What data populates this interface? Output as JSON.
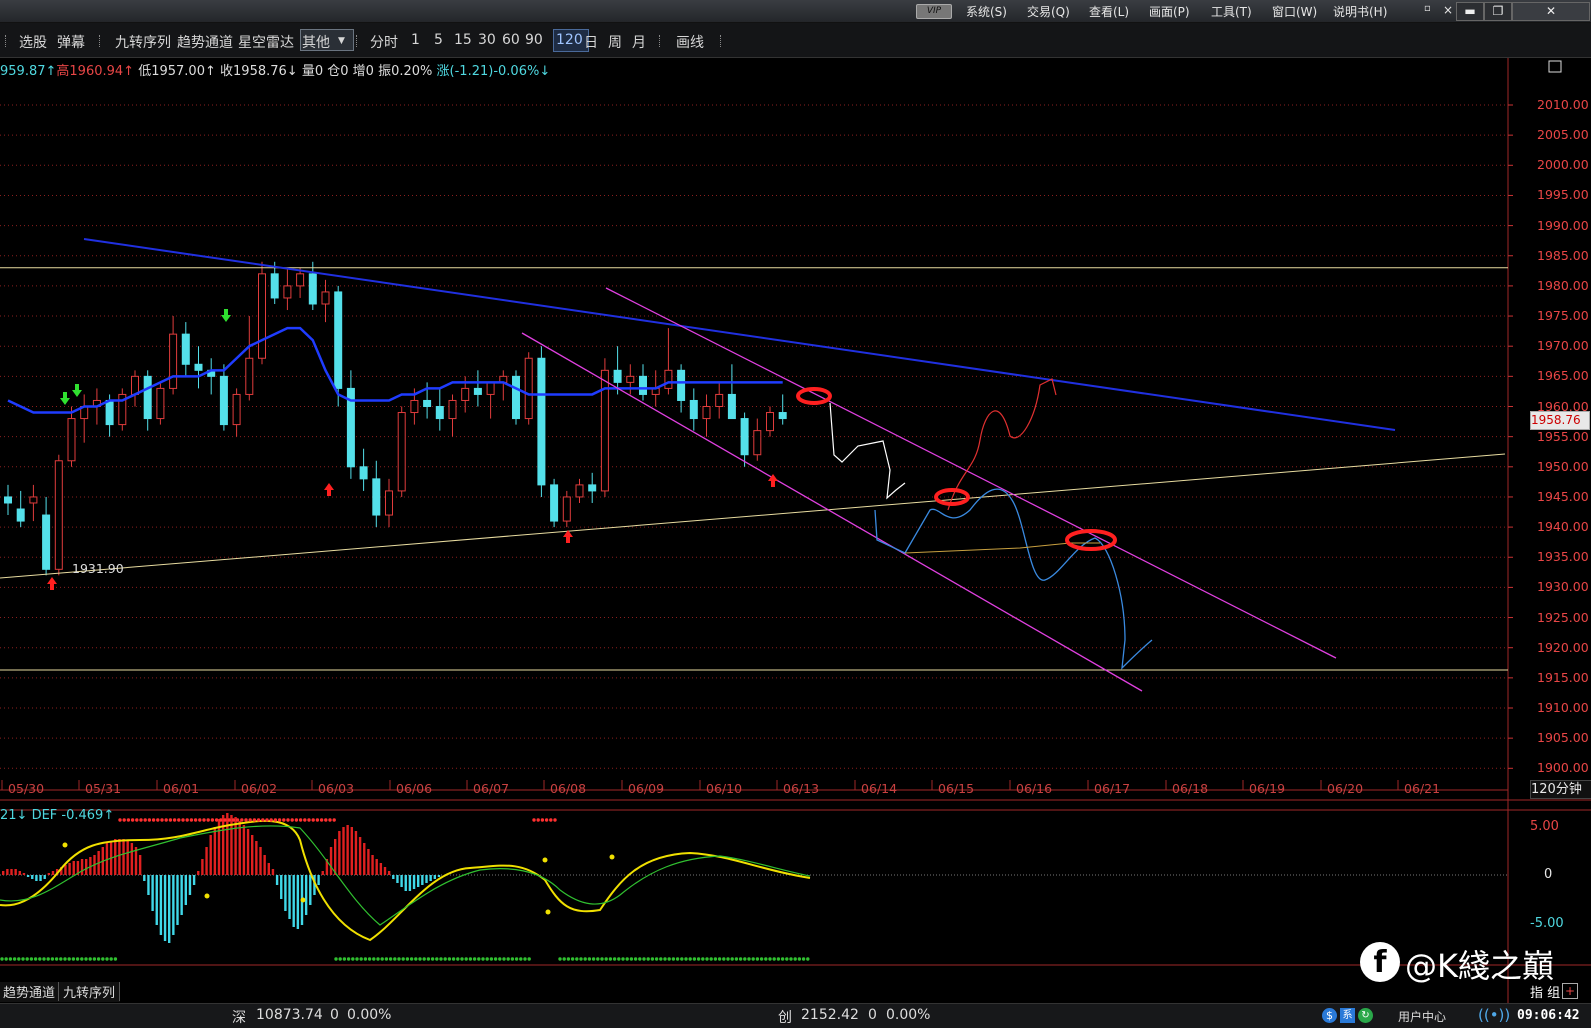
{
  "menu": [
    "系统(S)",
    "交易(Q)",
    "查看(L)",
    "画面(P)",
    "工具(T)",
    "窗口(W)",
    "说明书(H)"
  ],
  "vip": "VIP",
  "toolbar": {
    "items": [
      "选股",
      "弹幕",
      "九转序列",
      "趋势通道",
      "星空雷达"
    ],
    "dropdown": "其他",
    "periods": [
      "分时",
      "1",
      "5",
      "15",
      "30",
      "60",
      "90",
      "120",
      "日",
      "周",
      "月"
    ],
    "draw": "画线",
    "selected_period": "120"
  },
  "infobar": {
    "open": "959.87↑",
    "high_label": "高",
    "high": "1960.94↑",
    "low_label": "低",
    "low": "1957.00↑",
    "close_label": "收",
    "close": "1958.76↓",
    "vol": "量0",
    "pos": "仓0",
    "inc": "增0",
    "amp": "振0.20%",
    "chg": "涨(-1.21)-0.06%↓"
  },
  "current_price": "1958.76",
  "low_marker": "1931.90",
  "period_label": "120分钟",
  "indicator": {
    "left": "21↓",
    "def": "DEF -0.469↑",
    "ticks": [
      "5.00",
      "0",
      "-5.00",
      "0"
    ]
  },
  "bottom_tabs": [
    "趋势通道",
    "九转序列"
  ],
  "right_tabs": "指 组",
  "status": {
    "sz_label": "深",
    "sz_value": "10873.74",
    "sz_chg": "0",
    "sz_pct": "0.00%",
    "cy_label": "创",
    "cy_value": "2152.42",
    "cy_chg": "0",
    "cy_pct": "0.00%",
    "user_center": "用户中心",
    "time": "09:06:42"
  },
  "watermark": "@K綫之巔",
  "chart_data": {
    "type": "candlestick",
    "period": "120分钟",
    "y_ticks": [
      "2010.00",
      "2005.00",
      "2000.00",
      "1995.00",
      "1990.00",
      "1985.00",
      "1980.00",
      "1975.00",
      "1970.00",
      "1965.00",
      "1960.00",
      "1955.00",
      "1950.00",
      "1945.00",
      "1940.00",
      "1935.00",
      "1930.00",
      "1925.00",
      "1920.00",
      "1915.00",
      "1910.00",
      "1905.00",
      "1900.00"
    ],
    "ylim": [
      1900,
      2010
    ],
    "x_ticks": [
      "05/30",
      "05/31",
      "06/01",
      "06/02",
      "06/03",
      "06/06",
      "06/07",
      "06/08",
      "06/09",
      "06/10",
      "06/13",
      "06/14",
      "06/15",
      "06/16",
      "06/17",
      "06/18",
      "06/19",
      "06/20",
      "06/21"
    ],
    "candles": [
      [
        1945,
        1947,
        1942,
        1944
      ],
      [
        1943,
        1946,
        1940,
        1941
      ],
      [
        1944,
        1947,
        1941,
        1945
      ],
      [
        1942,
        1945,
        1932,
        1933
      ],
      [
        1933,
        1952,
        1932,
        1951
      ],
      [
        1951,
        1960,
        1950,
        1958
      ],
      [
        1958,
        1962,
        1954,
        1960
      ],
      [
        1960,
        1963,
        1957,
        1961
      ],
      [
        1961,
        1962,
        1955,
        1957
      ],
      [
        1957,
        1963,
        1956,
        1962
      ],
      [
        1962,
        1966,
        1960,
        1965
      ],
      [
        1965,
        1966,
        1956,
        1958
      ],
      [
        1958,
        1964,
        1957,
        1963
      ],
      [
        1963,
        1975,
        1962,
        1972
      ],
      [
        1972,
        1974,
        1965,
        1967
      ],
      [
        1967,
        1970,
        1963,
        1966
      ],
      [
        1966,
        1968,
        1962,
        1965
      ],
      [
        1965,
        1967,
        1956,
        1957
      ],
      [
        1957,
        1963,
        1955,
        1962
      ],
      [
        1962,
        1975,
        1961,
        1968
      ],
      [
        1968,
        1984,
        1967,
        1982
      ],
      [
        1982,
        1984,
        1977,
        1978
      ],
      [
        1978,
        1983,
        1976,
        1980
      ],
      [
        1980,
        1983,
        1978,
        1982
      ],
      [
        1982,
        1984,
        1976,
        1977
      ],
      [
        1977,
        1981,
        1974,
        1979
      ],
      [
        1979,
        1980,
        1960,
        1963
      ],
      [
        1963,
        1966,
        1948,
        1950
      ],
      [
        1950,
        1953,
        1946,
        1948
      ],
      [
        1948,
        1951,
        1940,
        1942
      ],
      [
        1942,
        1948,
        1940,
        1946
      ],
      [
        1946,
        1960,
        1945,
        1959
      ],
      [
        1959,
        1963,
        1957,
        1961
      ],
      [
        1961,
        1964,
        1958,
        1960
      ],
      [
        1960,
        1963,
        1956,
        1958
      ],
      [
        1958,
        1962,
        1955,
        1961
      ],
      [
        1961,
        1965,
        1959,
        1963
      ],
      [
        1963,
        1966,
        1960,
        1962
      ],
      [
        1962,
        1964,
        1958,
        1964
      ],
      [
        1964,
        1966,
        1961,
        1965
      ],
      [
        1965,
        1966,
        1957,
        1958
      ],
      [
        1958,
        1969,
        1957,
        1968
      ],
      [
        1968,
        1970,
        1945,
        1947
      ],
      [
        1947,
        1948,
        1940,
        1941
      ],
      [
        1941,
        1946,
        1940,
        1945
      ],
      [
        1945,
        1948,
        1944,
        1947
      ],
      [
        1947,
        1949,
        1944,
        1946
      ],
      [
        1946,
        1968,
        1945,
        1966
      ],
      [
        1966,
        1970,
        1962,
        1964
      ],
      [
        1964,
        1967,
        1962,
        1965
      ],
      [
        1965,
        1967,
        1961,
        1962
      ],
      [
        1962,
        1966,
        1960,
        1963
      ],
      [
        1963,
        1973,
        1962,
        1966
      ],
      [
        1966,
        1967,
        1959,
        1961
      ],
      [
        1961,
        1963,
        1956,
        1958
      ],
      [
        1958,
        1962,
        1955,
        1960
      ],
      [
        1960,
        1964,
        1958,
        1962
      ],
      [
        1962,
        1967,
        1960,
        1958
      ],
      [
        1958,
        1959,
        1950,
        1952
      ],
      [
        1952,
        1958,
        1951,
        1956
      ],
      [
        1956,
        1960,
        1955,
        1959
      ],
      [
        1959,
        1962,
        1957,
        1958
      ]
    ],
    "ma_line": [
      1961,
      1960,
      1959,
      1959,
      1959,
      1959,
      1960,
      1960,
      1961,
      1961,
      1962,
      1963,
      1964,
      1965,
      1965,
      1965,
      1966,
      1966,
      1968,
      1970,
      1971,
      1972,
      1973,
      1973,
      1971,
      1966,
      1962,
      1961,
      1961,
      1961,
      1961,
      1962,
      1962,
      1963,
      1963,
      1964,
      1964,
      1964,
      1964,
      1964,
      1963,
      1962,
      1962,
      1962,
      1962,
      1962,
      1962,
      1963,
      1963,
      1963,
      1963,
      1963,
      1964,
      1964,
      1964,
      1964,
      1964,
      1964,
      1964,
      1964,
      1964,
      1964
    ]
  }
}
